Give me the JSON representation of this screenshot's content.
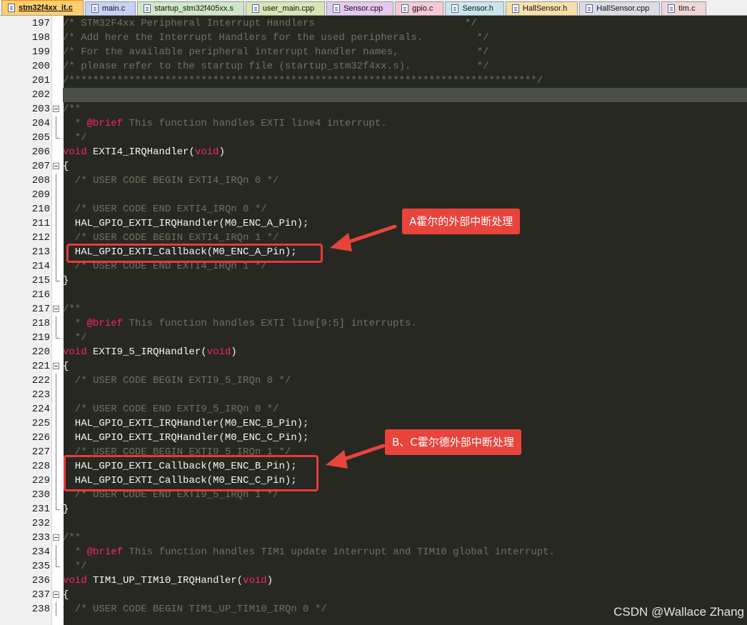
{
  "tabs": [
    {
      "label": "stm32f4xx_it.c",
      "color": "#ffcf6e",
      "active": true
    },
    {
      "label": "main.c",
      "color": "#c9d0f5",
      "active": false
    },
    {
      "label": "startup_stm32f405xx.s",
      "color": "#cfe7c5",
      "active": false
    },
    {
      "label": "user_main.cpp",
      "color": "#d8e6b5",
      "active": false
    },
    {
      "label": "Sensor.cpp",
      "color": "#e5c7ef",
      "active": false
    },
    {
      "label": "gpio.c",
      "color": "#f4c9d6",
      "active": false
    },
    {
      "label": "Sensor.h",
      "color": "#c8e6ed",
      "active": false
    },
    {
      "label": "HallSensor.h",
      "color": "#f6dfa9",
      "active": false
    },
    {
      "label": "HallSensor.cpp",
      "color": "#dcdce8",
      "active": false
    },
    {
      "label": "tim.c",
      "color": "#f0d6d6",
      "active": false
    }
  ],
  "lines": [
    {
      "n": "197",
      "parts": [
        {
          "t": "/* STM32F4xx Peripheral Interrupt Handlers                         */",
          "c": "comment"
        }
      ]
    },
    {
      "n": "198",
      "parts": [
        {
          "t": "/* Add here the Interrupt Handlers for the used peripherals.         */",
          "c": "comment"
        }
      ]
    },
    {
      "n": "199",
      "parts": [
        {
          "t": "/* For the available peripheral interrupt handler names,             */",
          "c": "comment"
        }
      ]
    },
    {
      "n": "200",
      "parts": [
        {
          "t": "/* please refer to the startup file (startup_stm32f4xx.s).           */",
          "c": "comment"
        }
      ]
    },
    {
      "n": "201",
      "parts": [
        {
          "t": "/******************************************************************************/",
          "c": "comment"
        }
      ]
    },
    {
      "n": "202",
      "parts": [],
      "current": true
    },
    {
      "n": "203",
      "fold": "open",
      "parts": [
        {
          "t": "/**",
          "c": "comment"
        }
      ]
    },
    {
      "n": "204",
      "fold": "line",
      "parts": [
        {
          "t": "  * ",
          "c": "comment"
        },
        {
          "t": "@brief",
          "c": "tag"
        },
        {
          "t": " This function handles EXTI line4 interrupt.",
          "c": "comment"
        }
      ]
    },
    {
      "n": "205",
      "fold": "end",
      "parts": [
        {
          "t": "  */",
          "c": "comment"
        }
      ]
    },
    {
      "n": "206",
      "parts": [
        {
          "t": "void",
          "c": "key"
        },
        {
          "t": " EXTI4_IRQHandler(",
          "c": ""
        },
        {
          "t": "void",
          "c": "key"
        },
        {
          "t": ")",
          "c": ""
        }
      ]
    },
    {
      "n": "207",
      "fold": "open",
      "parts": [
        {
          "t": "{",
          "c": ""
        }
      ]
    },
    {
      "n": "208",
      "fold": "line",
      "parts": [
        {
          "t": "  /* USER CODE BEGIN EXTI4_IRQn 0 */",
          "c": "comment"
        }
      ]
    },
    {
      "n": "209",
      "fold": "line",
      "parts": []
    },
    {
      "n": "210",
      "fold": "line",
      "parts": [
        {
          "t": "  /* USER CODE END EXTI4_IRQn 0 */",
          "c": "comment"
        }
      ]
    },
    {
      "n": "211",
      "fold": "line",
      "parts": [
        {
          "t": "  HAL_GPIO_EXTI_IRQHandler(M0_ENC_A_Pin);",
          "c": ""
        }
      ]
    },
    {
      "n": "212",
      "fold": "line",
      "parts": [
        {
          "t": "  /* USER CODE BEGIN EXTI4_IRQn 1 */",
          "c": "comment"
        }
      ]
    },
    {
      "n": "213",
      "fold": "line",
      "parts": [
        {
          "t": "  HAL_GPIO_EXTI_Callback(M0_ENC_A_Pin);",
          "c": ""
        }
      ]
    },
    {
      "n": "214",
      "fold": "line",
      "parts": [
        {
          "t": "  /* USER CODE END EXTI4_IRQn 1 */",
          "c": "comment"
        }
      ]
    },
    {
      "n": "215",
      "fold": "end",
      "parts": [
        {
          "t": "}",
          "c": ""
        }
      ]
    },
    {
      "n": "216",
      "parts": []
    },
    {
      "n": "217",
      "fold": "open",
      "parts": [
        {
          "t": "/**",
          "c": "comment"
        }
      ]
    },
    {
      "n": "218",
      "fold": "line",
      "parts": [
        {
          "t": "  * ",
          "c": "comment"
        },
        {
          "t": "@brief",
          "c": "tag"
        },
        {
          "t": " This function handles EXTI line[9:5] interrupts.",
          "c": "comment"
        }
      ]
    },
    {
      "n": "219",
      "fold": "end",
      "parts": [
        {
          "t": "  */",
          "c": "comment"
        }
      ]
    },
    {
      "n": "220",
      "parts": [
        {
          "t": "void",
          "c": "key"
        },
        {
          "t": " EXTI9_5_IRQHandler(",
          "c": ""
        },
        {
          "t": "void",
          "c": "key"
        },
        {
          "t": ")",
          "c": ""
        }
      ]
    },
    {
      "n": "221",
      "fold": "open",
      "parts": [
        {
          "t": "{",
          "c": ""
        }
      ]
    },
    {
      "n": "222",
      "fold": "line",
      "parts": [
        {
          "t": "  /* USER CODE BEGIN EXTI9_5_IRQn 0 */",
          "c": "comment"
        }
      ]
    },
    {
      "n": "223",
      "fold": "line",
      "parts": []
    },
    {
      "n": "224",
      "fold": "line",
      "parts": [
        {
          "t": "  /* USER CODE END EXTI9_5_IRQn 0 */",
          "c": "comment"
        }
      ]
    },
    {
      "n": "225",
      "fold": "line",
      "parts": [
        {
          "t": "  HAL_GPIO_EXTI_IRQHandler(M0_ENC_B_Pin);",
          "c": ""
        }
      ]
    },
    {
      "n": "226",
      "fold": "line",
      "parts": [
        {
          "t": "  HAL_GPIO_EXTI_IRQHandler(M0_ENC_C_Pin);",
          "c": ""
        }
      ]
    },
    {
      "n": "227",
      "fold": "line",
      "parts": [
        {
          "t": "  /* USER CODE BEGIN EXTI9_5_IRQn 1 */",
          "c": "comment"
        }
      ]
    },
    {
      "n": "228",
      "fold": "line",
      "parts": [
        {
          "t": "  HAL_GPIO_EXTI_Callback(M0_ENC_B_Pin);",
          "c": ""
        }
      ]
    },
    {
      "n": "229",
      "fold": "line",
      "parts": [
        {
          "t": "  HAL_GPIO_EXTI_Callback(M0_ENC_C_Pin);",
          "c": ""
        }
      ]
    },
    {
      "n": "230",
      "fold": "line",
      "parts": [
        {
          "t": "  /* USER CODE END EXTI9_5_IRQn 1 */",
          "c": "comment"
        }
      ]
    },
    {
      "n": "231",
      "fold": "end",
      "parts": [
        {
          "t": "}",
          "c": ""
        }
      ]
    },
    {
      "n": "232",
      "parts": []
    },
    {
      "n": "233",
      "fold": "open",
      "parts": [
        {
          "t": "/**",
          "c": "comment"
        }
      ]
    },
    {
      "n": "234",
      "fold": "line",
      "parts": [
        {
          "t": "  * ",
          "c": "comment"
        },
        {
          "t": "@brief",
          "c": "tag"
        },
        {
          "t": " This function handles TIM1 update interrupt and TIM10 global interrupt.",
          "c": "comment"
        }
      ]
    },
    {
      "n": "235",
      "fold": "end",
      "parts": [
        {
          "t": "  */",
          "c": "comment"
        }
      ]
    },
    {
      "n": "236",
      "parts": [
        {
          "t": "void",
          "c": "key"
        },
        {
          "t": " TIM1_UP_TIM10_IRQHandler(",
          "c": ""
        },
        {
          "t": "void",
          "c": "key"
        },
        {
          "t": ")",
          "c": ""
        }
      ]
    },
    {
      "n": "237",
      "fold": "open",
      "parts": [
        {
          "t": "{",
          "c": ""
        }
      ]
    },
    {
      "n": "238",
      "fold": "line",
      "parts": [
        {
          "t": "  /* USER CODE BEGIN TIM1_UP_TIM10_IRQn 0 */",
          "c": "comment"
        }
      ]
    }
  ],
  "annotations": {
    "callout_a": "A霍尔的外部中断处理",
    "callout_bc": "B、C霍尔德外部中断处理",
    "accent_color": "#e8443c"
  },
  "watermark": "CSDN @Wallace Zhang",
  "theme": {
    "background": "#272822",
    "comment": "#75715e",
    "keyword": "#f92672",
    "text": "#f8f8f2",
    "current_line": "#4b5044"
  }
}
